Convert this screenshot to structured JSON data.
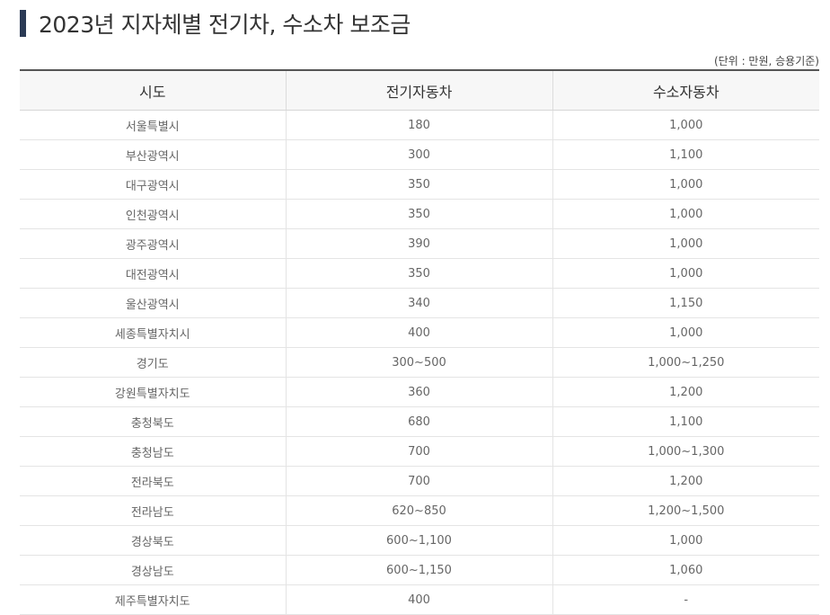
{
  "title": "2023년 지자체별 전기차, 수소차 보조금",
  "unit_note": "(단위 : 만원, 승용기준)",
  "table": {
    "headers": [
      "시도",
      "전기자동차",
      "수소자동차"
    ],
    "rows": [
      [
        "서울특별시",
        "180",
        "1,000"
      ],
      [
        "부산광역시",
        "300",
        "1,100"
      ],
      [
        "대구광역시",
        "350",
        "1,000"
      ],
      [
        "인천광역시",
        "350",
        "1,000"
      ],
      [
        "광주광역시",
        "390",
        "1,000"
      ],
      [
        "대전광역시",
        "350",
        "1,000"
      ],
      [
        "울산광역시",
        "340",
        "1,150"
      ],
      [
        "세종특별자치시",
        "400",
        "1,000"
      ],
      [
        "경기도",
        "300~500",
        "1,000~1,250"
      ],
      [
        "강원특별자치도",
        "360",
        "1,200"
      ],
      [
        "충청북도",
        "680",
        "1,100"
      ],
      [
        "충청남도",
        "700",
        "1,000~1,300"
      ],
      [
        "전라북도",
        "700",
        "1,200"
      ],
      [
        "전라남도",
        "620~850",
        "1,200~1,500"
      ],
      [
        "경상북도",
        "600~1,100",
        "1,000"
      ],
      [
        "경상남도",
        "600~1,150",
        "1,060"
      ],
      [
        "제주특별자치도",
        "400",
        "-"
      ]
    ]
  },
  "colors": {
    "title_bar": "#2b3a55",
    "header_bg": "#f7f7f7"
  }
}
